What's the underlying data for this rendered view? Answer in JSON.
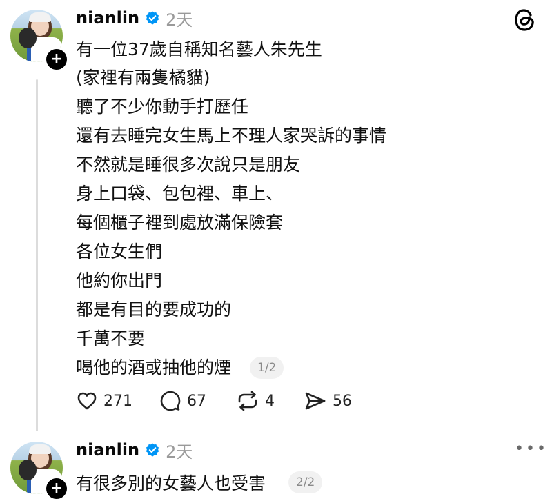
{
  "app": {
    "logo_icon": "threads-logo-icon"
  },
  "post1": {
    "username": "nianlin",
    "time": "2天",
    "lines": [
      "有一位37歲自稱知名藝人朱先生",
      "(家裡有兩隻橘貓)",
      "聽了不少你動手打歷任",
      "還有去睡完女生馬上不理人家哭訴的事情",
      "不然就是睡很多次說只是朋友",
      "身上口袋、包包裡、車上、",
      "每個櫃子裡到處放滿保險套",
      "各位女生們",
      "他約你出門",
      "都是有目的要成功的",
      "千萬不要",
      "喝他的酒或抽他的煙"
    ],
    "page_indicator": "1/2",
    "actions": {
      "likes": "271",
      "comments": "67",
      "reposts": "4",
      "shares": "56"
    }
  },
  "post2": {
    "username": "nianlin",
    "time": "2天",
    "text": "有很多別的女藝人也受害",
    "page_indicator": "2/2"
  },
  "colors": {
    "verified": "#0095f6",
    "text": "#101010",
    "muted": "#9a9a9a"
  }
}
